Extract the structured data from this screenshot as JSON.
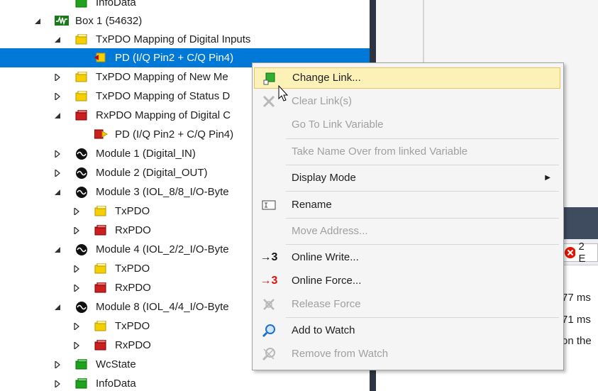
{
  "tree": {
    "rows": [
      {
        "label": "InfoData",
        "expander": "none",
        "icon": "green-folder-icon"
      },
      {
        "label": "Box 1 (54632)",
        "expander": "expanded",
        "icon": "box-device-icon"
      },
      {
        "label": "TxPDO Mapping of Digital Inputs",
        "expander": "expanded",
        "icon": "yellow-folder-icon"
      },
      {
        "label": "PD (I/Q Pin2 + C/Q Pin4)",
        "expander": "none",
        "icon": "input-variable-icon"
      },
      {
        "label": "TxPDO Mapping of New Me",
        "expander": "collapsed",
        "icon": "yellow-folder-icon"
      },
      {
        "label": "TxPDO Mapping of Status D",
        "expander": "collapsed",
        "icon": "yellow-folder-icon"
      },
      {
        "label": "RxPDO Mapping of Digital C",
        "expander": "expanded",
        "icon": "red-folder-icon"
      },
      {
        "label": "PD (I/Q Pin2 + C/Q Pin4)",
        "expander": "none",
        "icon": "output-variable-icon"
      },
      {
        "label": "Module 1 (Digital_IN)",
        "expander": "collapsed",
        "icon": "module-icon"
      },
      {
        "label": "Module 2 (Digital_OUT)",
        "expander": "collapsed",
        "icon": "module-icon"
      },
      {
        "label": "Module 3 (IOL_8/8_I/O-Byte",
        "expander": "expanded",
        "icon": "module-icon"
      },
      {
        "label": "TxPDO",
        "expander": "collapsed",
        "icon": "yellow-folder-icon"
      },
      {
        "label": "RxPDO",
        "expander": "collapsed",
        "icon": "red-folder-icon"
      },
      {
        "label": "Module 4 (IOL_2/2_I/O-Byte",
        "expander": "expanded",
        "icon": "module-icon"
      },
      {
        "label": "TxPDO",
        "expander": "collapsed",
        "icon": "yellow-folder-icon"
      },
      {
        "label": "RxPDO",
        "expander": "collapsed",
        "icon": "red-folder-icon"
      },
      {
        "label": "Module 8 (IOL_4/4_I/O-Byte",
        "expander": "expanded",
        "icon": "module-icon"
      },
      {
        "label": "TxPDO",
        "expander": "collapsed",
        "icon": "yellow-folder-icon"
      },
      {
        "label": "RxPDO",
        "expander": "collapsed",
        "icon": "red-folder-icon"
      },
      {
        "label": "WcState",
        "expander": "collapsed",
        "icon": "green-folder-icon"
      },
      {
        "label": "InfoData",
        "expander": "collapsed",
        "icon": "green-folder-icon"
      }
    ],
    "selected_index": 3
  },
  "context_menu": {
    "items": [
      {
        "label": "Change Link...",
        "icon": "change-link-icon",
        "enabled": true,
        "hover": true
      },
      {
        "label": "Clear Link(s)",
        "icon": "clear-link-icon",
        "enabled": false
      },
      {
        "label": "Go To Link Variable",
        "icon": "",
        "enabled": false
      },
      {
        "label": "Take Name Over from linked Variable",
        "icon": "",
        "enabled": false
      },
      {
        "label": "Display Mode",
        "icon": "",
        "enabled": true,
        "submenu": true
      },
      {
        "label": "Rename",
        "icon": "rename-icon",
        "enabled": true
      },
      {
        "label": "Move Address...",
        "icon": "",
        "enabled": false
      },
      {
        "label": "Online Write...",
        "icon": "online-write-icon",
        "enabled": true
      },
      {
        "label": "Online Force...",
        "icon": "online-force-icon",
        "enabled": true
      },
      {
        "label": "Release Force",
        "icon": "release-force-icon",
        "enabled": false
      },
      {
        "label": "Add to Watch",
        "icon": "add-watch-icon",
        "enabled": true
      },
      {
        "label": "Remove from Watch",
        "icon": "remove-watch-icon",
        "enabled": false
      }
    ],
    "submenu_arrow": "▶",
    "online_write_glyph": "→3",
    "online_force_glyph": "→3"
  },
  "output_panel": {
    "error_badge": "2 E",
    "lines": [
      "77 ms",
      "71 ms",
      "on the"
    ]
  },
  "colors": {
    "selection": "#0078d7",
    "menu_hover_bg": "#fcf2b8",
    "menu_hover_border": "#e5c365",
    "disabled_text": "#a0a0a0",
    "dark_panel": "#2e3441"
  }
}
